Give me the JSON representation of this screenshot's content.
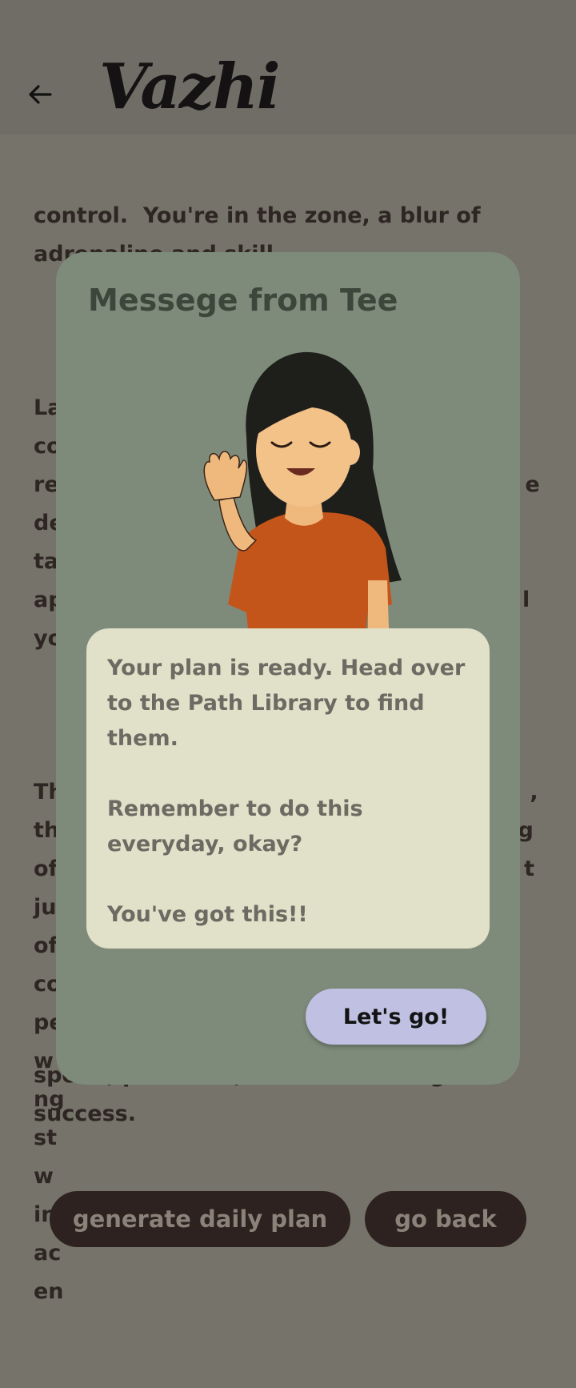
{
  "header": {
    "back_icon": "arrow-left-icon",
    "logo_text": "Vazhi"
  },
  "story": {
    "lines_top": "control.  You're in the zone, a blur of\nadrenaline and skill.",
    "para2": "Lap after lap, you push the limits, the\nco\nre                                                              e\nde\nta\nap                                                             l\nyo",
    "para3": "Th                                                              ,\nth                                                             g\nof                                                              t\nju\nof\nco\npe\nw                                                             ng\nst\nw\nin\nac\nen",
    "end": "speed, precision, and unwavering\nsuccess."
  },
  "modal": {
    "title": "Messege from Tee",
    "avatar_icon": "waving-girl-avatar",
    "message_paragraphs": [
      "Your plan is ready. Head over to the Path Library to find them.",
      "Remember to do this everyday, okay?",
      "You've got this!!"
    ],
    "confirm_label": "Let's go!"
  },
  "actions": {
    "generate_label": "generate daily plan",
    "back_label": "go back"
  },
  "colors": {
    "scrim": "#75736a",
    "modal_bg": "#7e8b7a",
    "message_bg": "#e1e0c8",
    "primary_btn": "#bfc0e2",
    "dark_btn": "#2e2220"
  }
}
